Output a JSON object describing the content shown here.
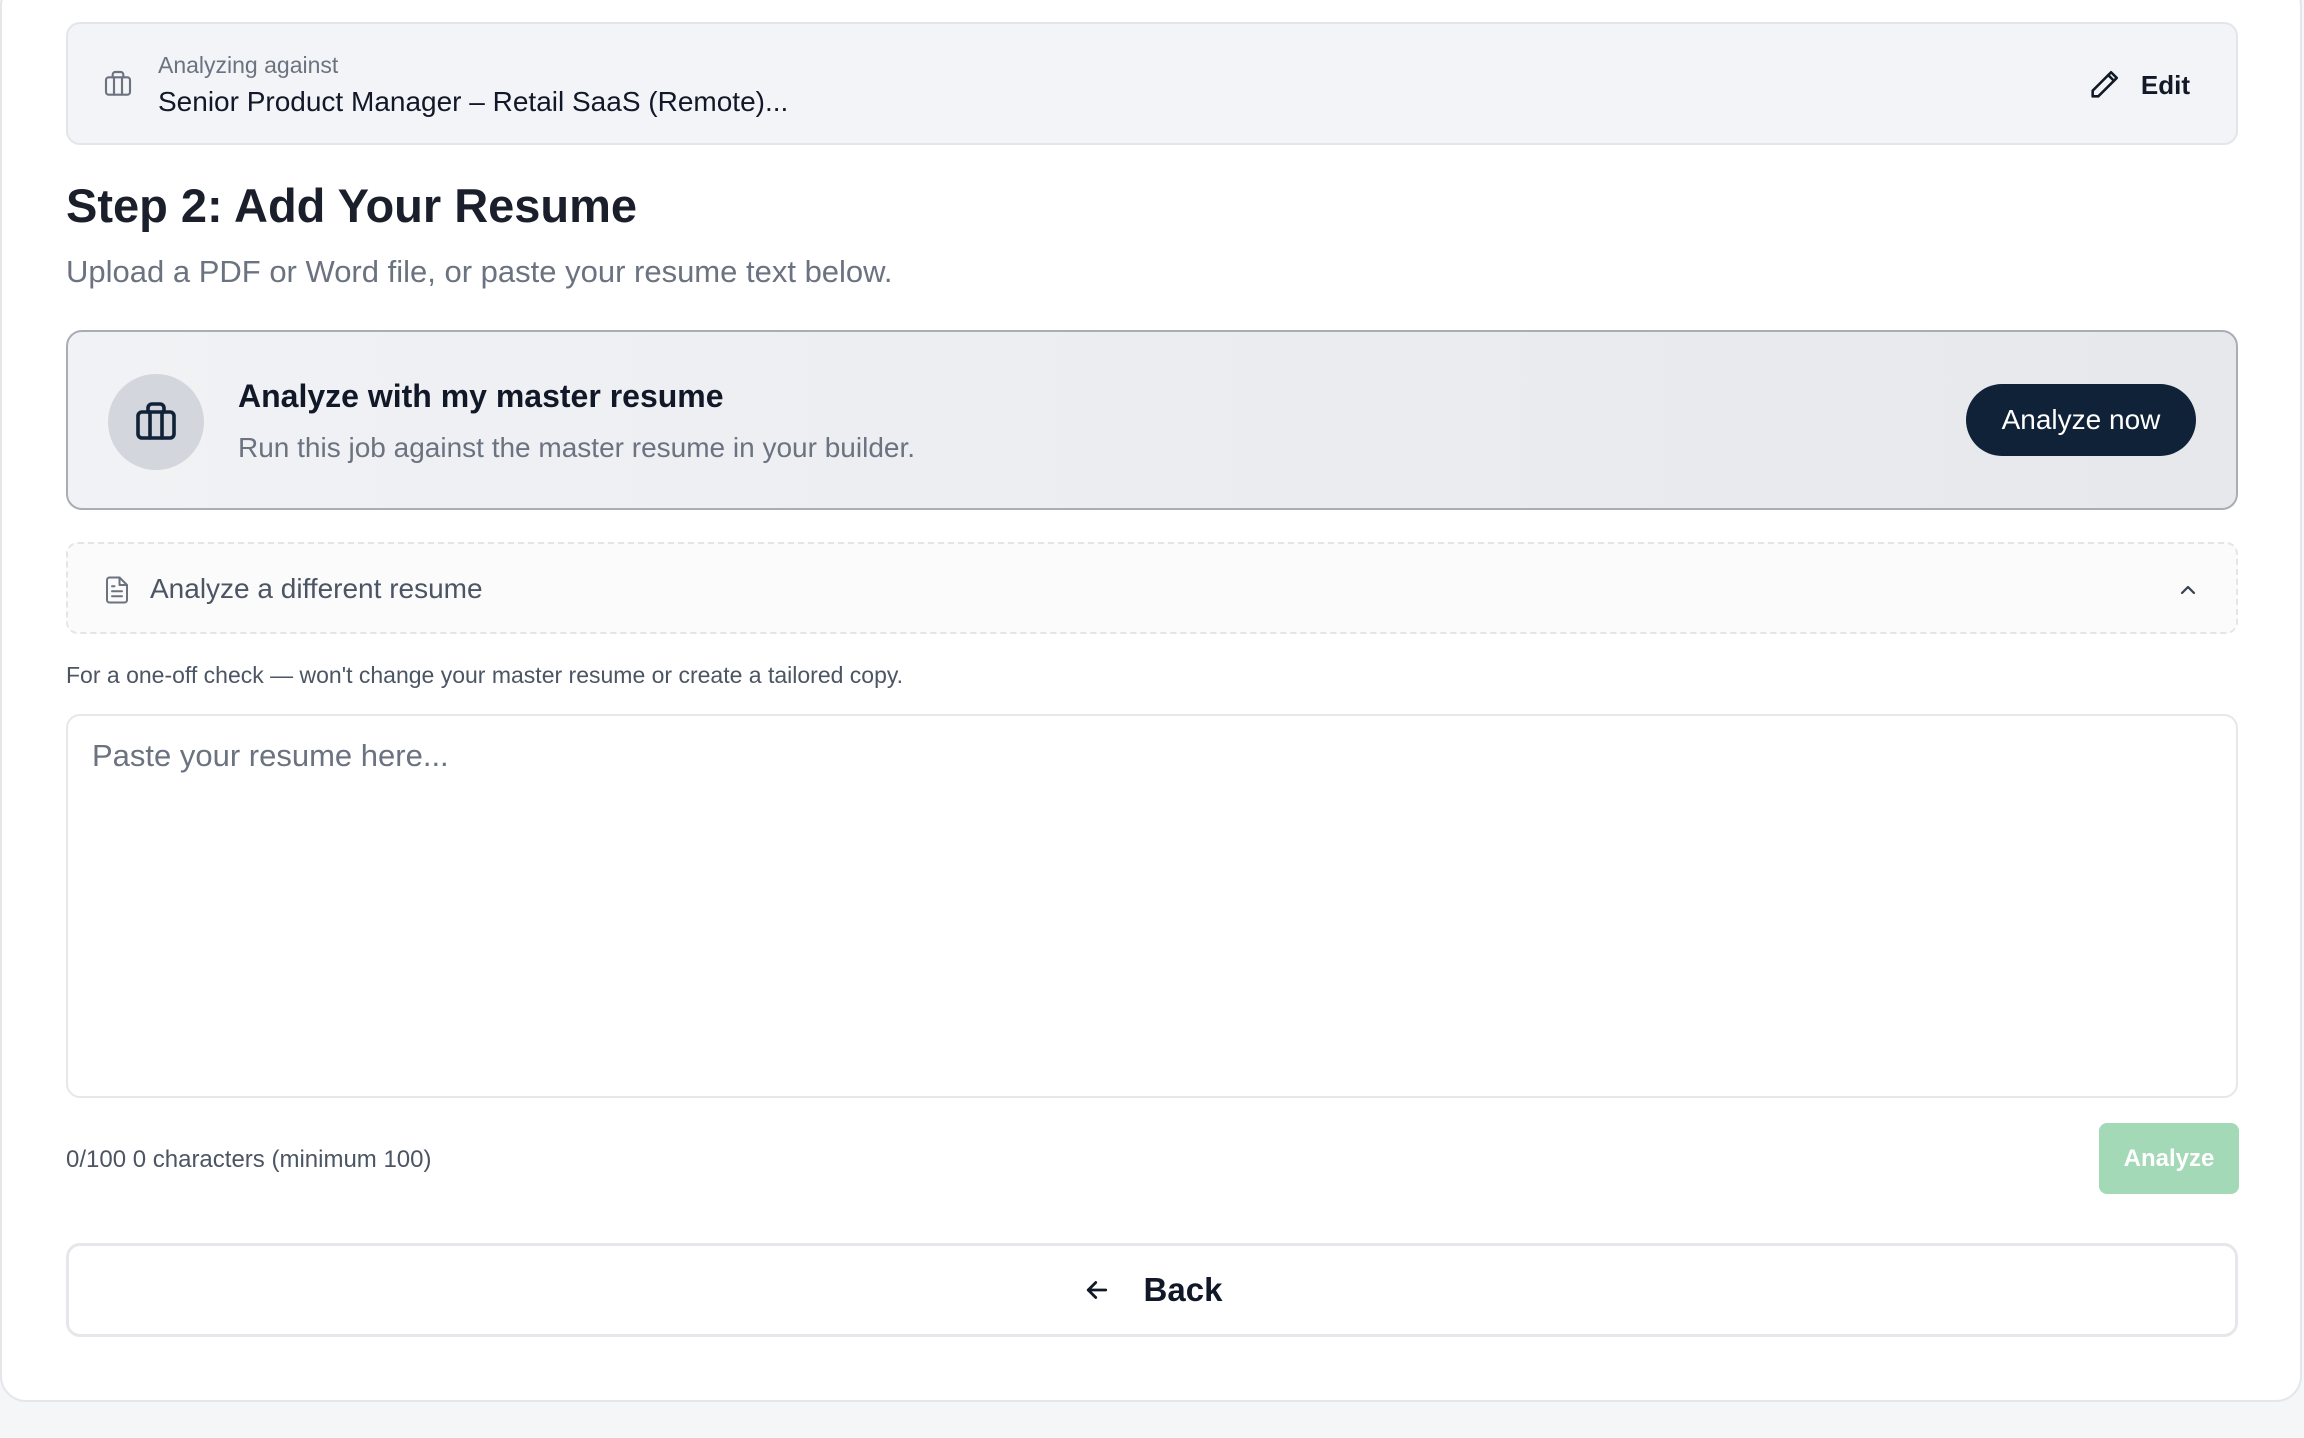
{
  "banner": {
    "label": "Analyzing against",
    "job_title": "Senior Product Manager – Retail SaaS (Remote)...",
    "edit_label": "Edit",
    "icon": "briefcase-icon"
  },
  "step": {
    "title": "Step 2: Add Your Resume",
    "subtitle": "Upload a PDF or Word file, or paste your resume text below."
  },
  "master_resume": {
    "title": "Analyze with my master resume",
    "description": "Run this job against the master resume in your builder.",
    "button_label": "Analyze now",
    "icon": "briefcase-icon"
  },
  "different_resume": {
    "label": "Analyze a different resume",
    "icon": "document-icon",
    "toggle_icon": "chevron-up-icon",
    "note": "For a one-off check — won't change your master resume or create a tailored copy."
  },
  "resume_input": {
    "value": "",
    "placeholder": "Paste your resume here..."
  },
  "counter": {
    "text": "0/100 0 characters (minimum 100)"
  },
  "analyze_button": {
    "label": "Analyze"
  },
  "back_button": {
    "label": "Back",
    "icon": "arrow-left-icon"
  },
  "colors": {
    "primary_dark": "#0f2238",
    "analyze_disabled": "#a3d9b7"
  }
}
